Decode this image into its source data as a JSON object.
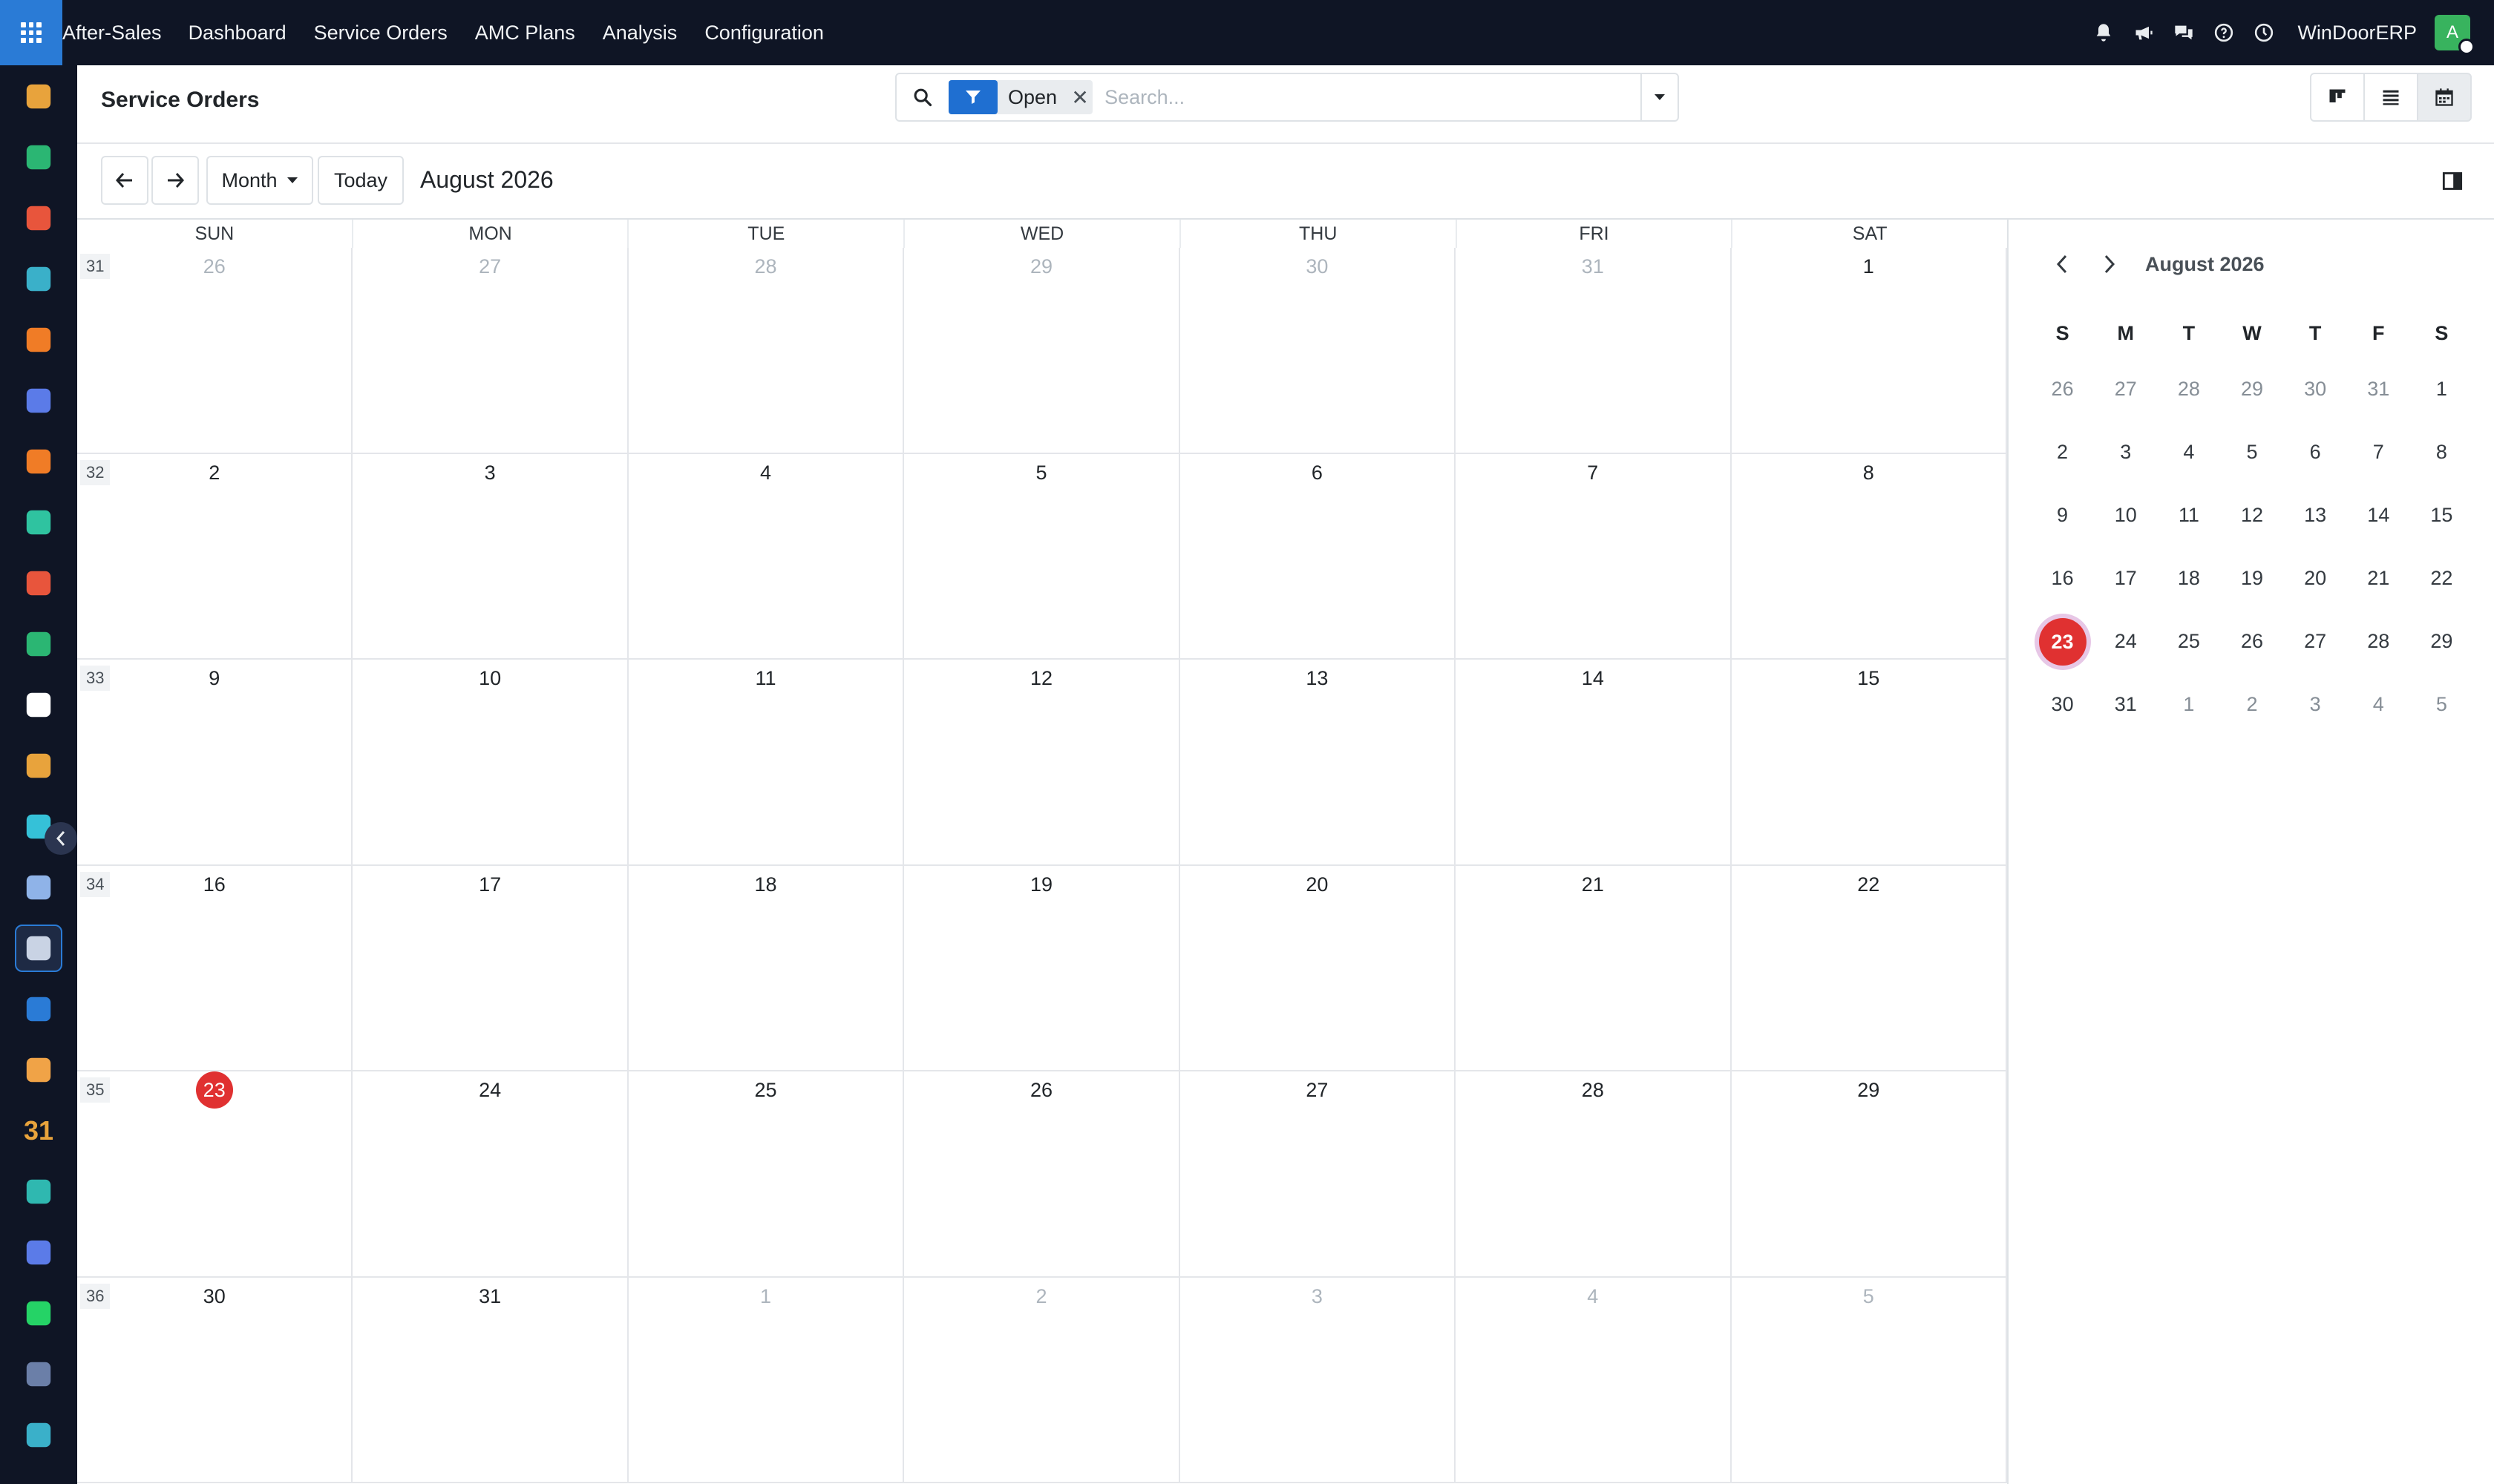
{
  "topbar": {
    "brand": "After-Sales",
    "menu": [
      "Dashboard",
      "Service Orders",
      "AMC Plans",
      "Analysis",
      "Configuration"
    ],
    "icons": [
      "bell-icon",
      "megaphone-icon",
      "chat-icon",
      "help-icon",
      "clock-icon"
    ],
    "company": "WinDoorERP",
    "avatar_initial": "A",
    "accent": "#2a7bd6"
  },
  "sidebar": {
    "apps": [
      {
        "name": "sidebar-app-1",
        "color": "#e8a33c"
      },
      {
        "name": "sidebar-app-2",
        "color": "#2bb673"
      },
      {
        "name": "sidebar-app-3",
        "color": "#e8553c"
      },
      {
        "name": "sidebar-app-4",
        "color": "#3ab0c9"
      },
      {
        "name": "sidebar-app-5",
        "color": "#f07c26"
      },
      {
        "name": "sidebar-app-6",
        "color": "#5b7be8"
      },
      {
        "name": "sidebar-app-7",
        "color": "#f07c26"
      },
      {
        "name": "sidebar-app-8",
        "color": "#2fc3a0"
      },
      {
        "name": "sidebar-app-9",
        "color": "#e8553c"
      },
      {
        "name": "sidebar-app-10",
        "color": "#2bb673"
      },
      {
        "name": "sidebar-app-11",
        "color": "#ffffff"
      },
      {
        "name": "sidebar-app-12",
        "color": "#e8a33c"
      },
      {
        "name": "sidebar-app-13",
        "color": "#35c1d8"
      },
      {
        "name": "sidebar-app-14",
        "color": "#8fb3e8"
      },
      {
        "name": "sidebar-app-15",
        "color": "#c9d3e4",
        "active": true
      },
      {
        "name": "sidebar-app-16",
        "color": "#2a7bd6"
      },
      {
        "name": "sidebar-app-17",
        "color": "#f0a347"
      },
      {
        "name": "sidebar-app-18",
        "color": "#e8a33c",
        "text": "31"
      },
      {
        "name": "sidebar-app-19",
        "color": "#2fb8b0"
      },
      {
        "name": "sidebar-app-20",
        "color": "#5b7be8"
      },
      {
        "name": "sidebar-app-21",
        "color": "#25d366"
      },
      {
        "name": "sidebar-app-22",
        "color": "#6b7fa8"
      },
      {
        "name": "sidebar-app-23",
        "color": "#3ab0c9"
      }
    ]
  },
  "control": {
    "title": "Service Orders",
    "facet_value": "Open",
    "search_placeholder": "Search...",
    "views": [
      "kanban-view-icon",
      "list-view-icon",
      "calendar-view-icon"
    ],
    "active_view": "calendar"
  },
  "nav": {
    "scale": "Month",
    "today_label": "Today",
    "period": "August 2026"
  },
  "calendar": {
    "day_headers": [
      "SUN",
      "MON",
      "TUE",
      "WED",
      "THU",
      "FRI",
      "SAT"
    ],
    "today": 23,
    "weeks": [
      {
        "num": "31",
        "days": [
          [
            26,
            0
          ],
          [
            27,
            0
          ],
          [
            28,
            0
          ],
          [
            29,
            0
          ],
          [
            30,
            0
          ],
          [
            31,
            0
          ],
          [
            1,
            1
          ]
        ]
      },
      {
        "num": "32",
        "days": [
          [
            2,
            1
          ],
          [
            3,
            1
          ],
          [
            4,
            1
          ],
          [
            5,
            1
          ],
          [
            6,
            1
          ],
          [
            7,
            1
          ],
          [
            8,
            1
          ]
        ]
      },
      {
        "num": "33",
        "days": [
          [
            9,
            1
          ],
          [
            10,
            1
          ],
          [
            11,
            1
          ],
          [
            12,
            1
          ],
          [
            13,
            1
          ],
          [
            14,
            1
          ],
          [
            15,
            1
          ]
        ]
      },
      {
        "num": "34",
        "days": [
          [
            16,
            1
          ],
          [
            17,
            1
          ],
          [
            18,
            1
          ],
          [
            19,
            1
          ],
          [
            20,
            1
          ],
          [
            21,
            1
          ],
          [
            22,
            1
          ]
        ]
      },
      {
        "num": "35",
        "days": [
          [
            23,
            1
          ],
          [
            24,
            1
          ],
          [
            25,
            1
          ],
          [
            26,
            1
          ],
          [
            27,
            1
          ],
          [
            28,
            1
          ],
          [
            29,
            1
          ]
        ]
      },
      {
        "num": "36",
        "days": [
          [
            30,
            1
          ],
          [
            31,
            1
          ],
          [
            1,
            0
          ],
          [
            2,
            0
          ],
          [
            3,
            0
          ],
          [
            4,
            0
          ],
          [
            5,
            0
          ]
        ]
      }
    ]
  },
  "mini": {
    "title": "August 2026",
    "headers": [
      "S",
      "M",
      "T",
      "W",
      "T",
      "F",
      "S"
    ],
    "today": 23,
    "weeks": [
      [
        [
          26,
          0
        ],
        [
          27,
          0
        ],
        [
          28,
          0
        ],
        [
          29,
          0
        ],
        [
          30,
          0
        ],
        [
          31,
          0
        ],
        [
          1,
          1
        ]
      ],
      [
        [
          2,
          1
        ],
        [
          3,
          1
        ],
        [
          4,
          1
        ],
        [
          5,
          1
        ],
        [
          6,
          1
        ],
        [
          7,
          1
        ],
        [
          8,
          1
        ]
      ],
      [
        [
          9,
          1
        ],
        [
          10,
          1
        ],
        [
          11,
          1
        ],
        [
          12,
          1
        ],
        [
          13,
          1
        ],
        [
          14,
          1
        ],
        [
          15,
          1
        ]
      ],
      [
        [
          16,
          1
        ],
        [
          17,
          1
        ],
        [
          18,
          1
        ],
        [
          19,
          1
        ],
        [
          20,
          1
        ],
        [
          21,
          1
        ],
        [
          22,
          1
        ]
      ],
      [
        [
          23,
          1
        ],
        [
          24,
          1
        ],
        [
          25,
          1
        ],
        [
          26,
          1
        ],
        [
          27,
          1
        ],
        [
          28,
          1
        ],
        [
          29,
          1
        ]
      ],
      [
        [
          30,
          1
        ],
        [
          31,
          1
        ],
        [
          1,
          0
        ],
        [
          2,
          0
        ],
        [
          3,
          0
        ],
        [
          4,
          0
        ],
        [
          5,
          0
        ]
      ]
    ]
  }
}
